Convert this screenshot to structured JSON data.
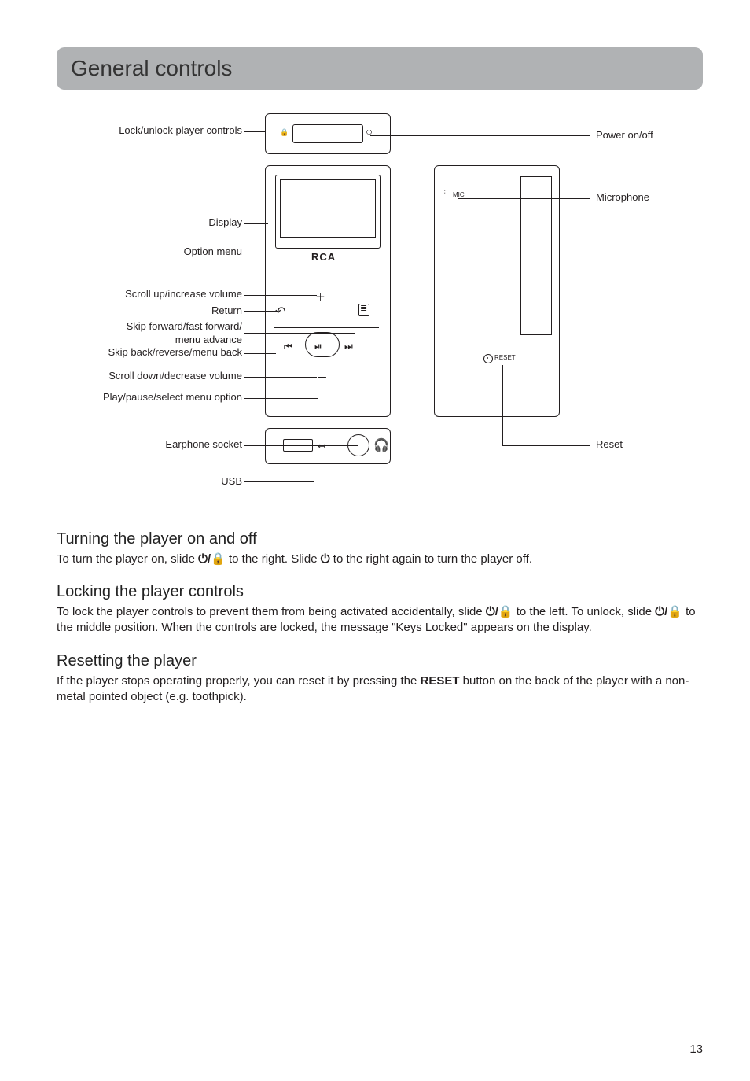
{
  "page_number": "13",
  "heading": "General controls",
  "labels": {
    "lock": "Lock/unlock player controls",
    "power": "Power on/off",
    "display": "Display",
    "option": "Option menu",
    "scrollup": "Scroll up/increase volume",
    "ret": "Return",
    "skipfwd": "Skip forward/fast forward/ menu advance",
    "skipback": "Skip back/reverse/menu back",
    "scrolldn": "Scroll down/decrease volume",
    "playpause": "Play/pause/select menu option",
    "earphone": "Earphone socket",
    "usb": "USB",
    "mic": "Microphone",
    "reset": "Reset"
  },
  "deviceText": {
    "logo": "RCA",
    "micLabel": "MIC",
    "resetLabel": "RESET"
  },
  "sections": {
    "s1_title": "Turning the player on and off",
    "s1_p1_a": "To turn the player on, slide ",
    "s1_p1_b": " to the right. Slide ",
    "s1_p1_c": " to the right again to turn the player off.",
    "s2_title": "Locking the player controls",
    "s2_p1_a": "To lock the player controls to prevent them from being activated accidentally, slide ",
    "s2_p1_b": " to the left.  To unlock, slide ",
    "s2_p1_c": " to the middle position. When the controls are locked, the message \"Keys Locked\" appears on the display.",
    "s3_title": "Resetting the player",
    "s3_p1_a": "If the player stops operating properly, you can reset it by pressing the ",
    "s3_p1_bold": "RESET",
    "s3_p1_b": " button on the back of the player with a non-metal pointed object (e.g. toothpick)."
  },
  "glyphs": {
    "powerLock": "⏻/🔒",
    "power": "⏻",
    "lock": "🔒",
    "return": "↶",
    "prev": "⏮",
    "play": "⏯",
    "next": "⏭",
    "plus": "＋",
    "minus": "－",
    "headphone": "🎧",
    "arrowIn": "↤"
  }
}
